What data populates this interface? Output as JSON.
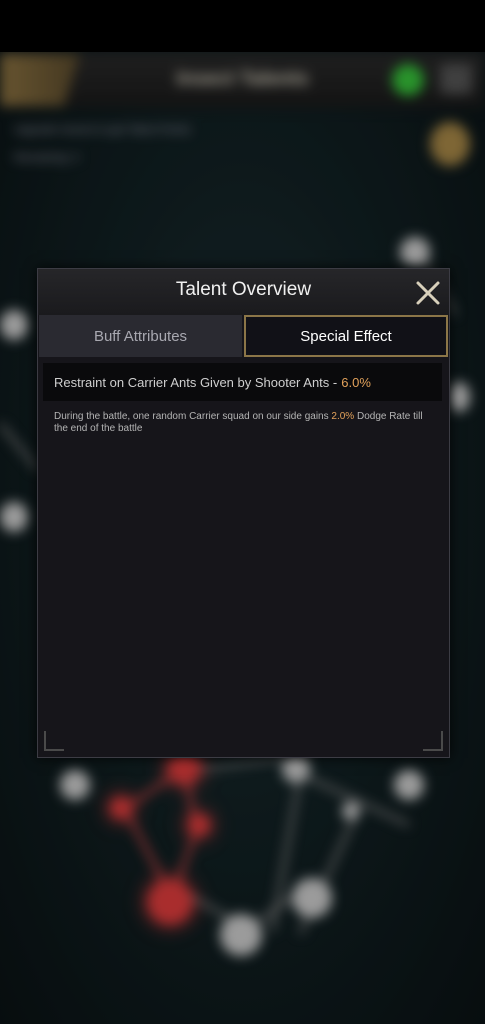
{
  "background": {
    "screen_title": "Insect Talents",
    "hint_text": "Upgrade Insects to get Talent Points",
    "remaining_label": "Remaining: 0"
  },
  "modal": {
    "title": "Talent Overview",
    "tabs": [
      {
        "label": "Buff Attributes",
        "selected": false
      },
      {
        "label": "Special Effect",
        "selected": true
      }
    ],
    "effect": {
      "name": "Restraint on Carrier Ants Given by Shooter Ants -",
      "value": "6.0%",
      "desc_pre": "During the battle, one random Carrier squad on our side gains",
      "desc_value": "2.0%",
      "desc_post": "Dodge Rate till the end of the battle"
    }
  },
  "colors": {
    "accent_gold": "#8c7648",
    "highlight_orange": "#e2a25b",
    "node_red": "#e23d3d"
  },
  "icons": [
    "back-arrow-icon",
    "close-icon",
    "green-status-icon",
    "share-icon",
    "gold-badge-icon"
  ]
}
